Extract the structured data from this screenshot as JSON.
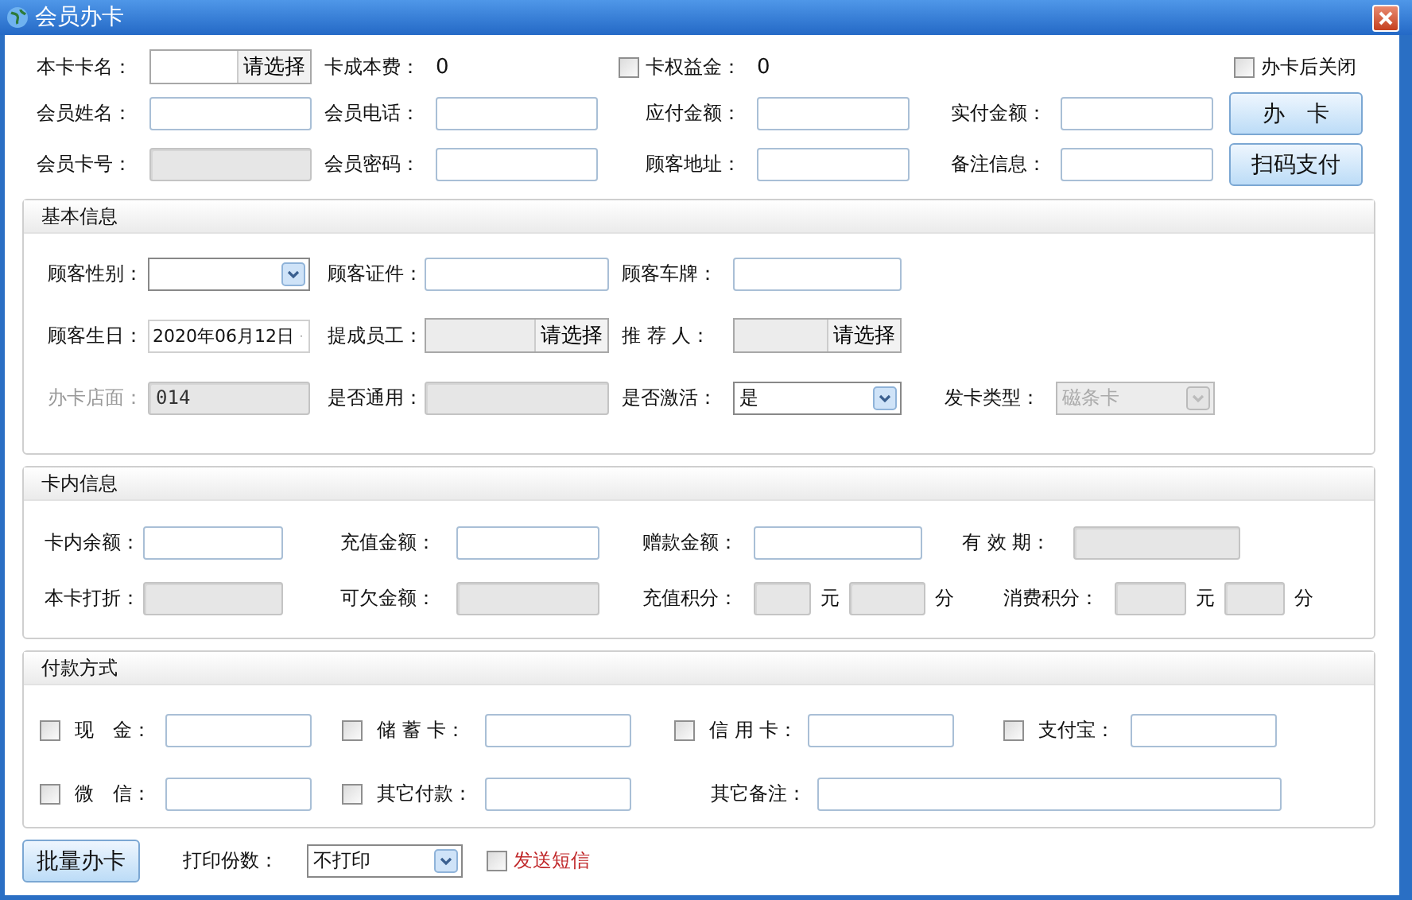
{
  "window": {
    "title": "会员办卡"
  },
  "form": {
    "close_after": {
      "label": "办卡后关闭",
      "checked": false
    },
    "rows": [
      [
        {
          "kind": "picker",
          "label": "本卡卡名：",
          "button": "请选择",
          "disabled": false
        },
        {
          "kind": "text",
          "label": "卡成本费：",
          "value": "0"
        },
        {
          "kind": "check_value",
          "label": "卡权益金：",
          "value": "0",
          "checked": false
        }
      ],
      [
        {
          "kind": "input",
          "label": "会员姓名：",
          "disabled": false
        },
        {
          "kind": "input",
          "label": "会员电话：",
          "disabled": false
        },
        {
          "kind": "input",
          "label": "应付金额：",
          "disabled": false
        },
        {
          "kind": "input",
          "label": "实付金额：",
          "disabled": false
        },
        {
          "kind": "button",
          "label": "办　卡"
        }
      ],
      [
        {
          "kind": "input",
          "label": "会员卡号：",
          "disabled": true
        },
        {
          "kind": "input",
          "label": "会员密码：",
          "disabled": false
        },
        {
          "kind": "input",
          "label": "顾客地址：",
          "disabled": false
        },
        {
          "kind": "input",
          "label": "备注信息：",
          "disabled": false
        },
        {
          "kind": "button",
          "label": "扫码支付"
        }
      ]
    ]
  },
  "sections": [
    {
      "title": "基本信息",
      "rows": [
        [
          {
            "kind": "select",
            "label": "顾客性别：",
            "disabled": false
          },
          {
            "kind": "input",
            "label": "顾客证件：",
            "disabled": false
          },
          {
            "kind": "input",
            "label": "顾客车牌：",
            "disabled": false
          }
        ],
        [
          {
            "kind": "date",
            "label": "顾客生日：",
            "value": "2020年06月12日"
          },
          {
            "kind": "picker",
            "label": "提成员工：",
            "button": "请选择",
            "disabled": true
          },
          {
            "kind": "picker",
            "label": "推 荐 人：",
            "button": "请选择",
            "disabled": true
          }
        ],
        [
          {
            "kind": "input",
            "label": "办卡店面：",
            "value": "014",
            "disabled": true,
            "label_greyed": true
          },
          {
            "kind": "input",
            "label": "是否通用：",
            "disabled": true
          },
          {
            "kind": "select",
            "label": "是否激活：",
            "value": "是",
            "disabled": false
          },
          {
            "kind": "select",
            "label": "发卡类型：",
            "value": "磁条卡",
            "disabled": true
          }
        ]
      ]
    },
    {
      "title": "卡内信息",
      "rows": [
        [
          {
            "kind": "input",
            "label": "卡内余额：",
            "disabled": false
          },
          {
            "kind": "input",
            "label": "充值金额：",
            "disabled": false
          },
          {
            "kind": "input",
            "label": "赠款金额：",
            "disabled": false
          },
          {
            "kind": "input",
            "label": "有 效 期：",
            "disabled": true
          }
        ],
        [
          {
            "kind": "input",
            "label": "本卡打折：",
            "disabled": true
          },
          {
            "kind": "input",
            "label": "可欠金额：",
            "disabled": true
          },
          {
            "kind": "points",
            "label": "充值积分：",
            "units": [
              "元",
              "分"
            ],
            "disabled": true
          },
          {
            "kind": "points",
            "label": "消费积分：",
            "units": [
              "元",
              "分"
            ],
            "disabled": true
          }
        ]
      ]
    },
    {
      "title": "付款方式",
      "rows": [
        [
          {
            "kind": "payment",
            "label": "现　金：",
            "checked": false
          },
          {
            "kind": "payment",
            "label": "储 蓄 卡：",
            "checked": false
          },
          {
            "kind": "payment",
            "label": "信 用 卡：",
            "checked": false
          },
          {
            "kind": "payment",
            "label": "支付宝：",
            "checked": false
          }
        ],
        [
          {
            "kind": "payment",
            "label": "微　信：",
            "checked": false
          },
          {
            "kind": "payment",
            "label": "其它付款：",
            "checked": false
          },
          {
            "kind": "note",
            "label": "其它备注："
          }
        ]
      ]
    }
  ],
  "footer": {
    "button": "批量办卡",
    "copies": {
      "label": "打印份数：",
      "value": "不打印"
    },
    "sms": {
      "label": "发送短信",
      "checked": false
    }
  }
}
